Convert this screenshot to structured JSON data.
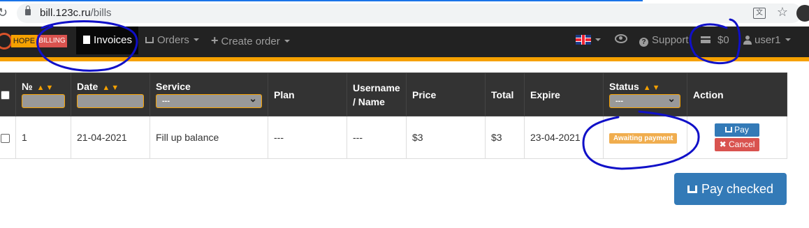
{
  "browser": {
    "url_host": "bill.123c.ru",
    "url_path": "/bills"
  },
  "navbar": {
    "brand_left": "HOPE",
    "brand_right": "BILLING",
    "invoices": "Invoices",
    "orders": "Orders",
    "create_order": "Create order",
    "support": "Support",
    "balance": "$0",
    "user": "user1"
  },
  "table": {
    "headers": {
      "number": "№",
      "date": "Date",
      "service": "Service",
      "plan": "Plan",
      "username": "Username / Name",
      "price": "Price",
      "total": "Total",
      "expire": "Expire",
      "status": "Status",
      "action": "Action"
    },
    "service_filter": "---",
    "status_filter": "---",
    "rows": [
      {
        "number": "1",
        "date": "21-04-2021",
        "service": "Fill up balance",
        "plan": "---",
        "username": "---",
        "price": "$3",
        "total": "$3",
        "expire": "23-04-2021",
        "status": "Awaiting payment",
        "pay": "Pay",
        "cancel": "Cancel"
      }
    ]
  },
  "pay_checked": "Pay checked",
  "colors": {
    "navbar": "#222222",
    "accent": "#f6a100",
    "primary": "#337ab7",
    "danger": "#d9534f",
    "warning": "#f0ad4e",
    "annotation": "#1010c8"
  }
}
